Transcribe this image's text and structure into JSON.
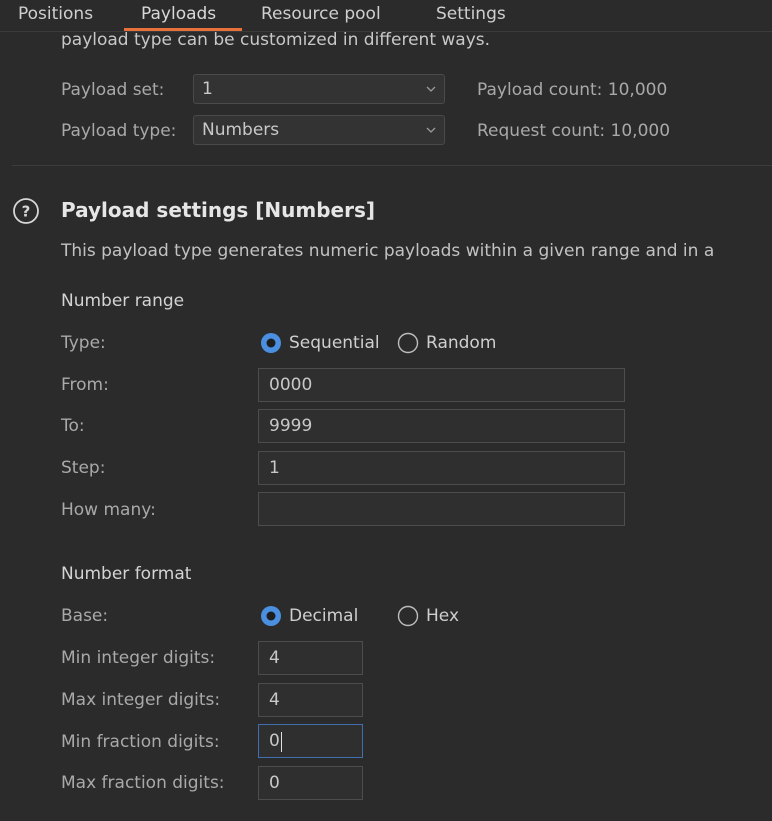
{
  "tabs": [
    {
      "label": "Positions"
    },
    {
      "label": "Payloads",
      "active": true
    },
    {
      "label": "Resource pool"
    },
    {
      "label": "Settings"
    }
  ],
  "payload_sets": {
    "intro_text": "payload type can be customized in different ways.",
    "set_label": "Payload set:",
    "set_value": "1",
    "type_label": "Payload type:",
    "type_value": "Numbers",
    "payload_count": "Payload count: 10,000",
    "request_count": "Request count: 10,000"
  },
  "payload_settings": {
    "title": "Payload settings [Numbers]",
    "description": "This payload type generates numeric payloads within a given range and in a",
    "number_range": {
      "heading": "Number range",
      "type_label": "Type:",
      "options": [
        "Sequential",
        "Random"
      ],
      "selected": "Sequential",
      "from_label": "From:",
      "from_value": "0000",
      "to_label": "To:",
      "to_value": "9999",
      "step_label": "Step:",
      "step_value": "1",
      "how_many_label": "How many:",
      "how_many_value": ""
    },
    "number_format": {
      "heading": "Number format",
      "base_label": "Base:",
      "options": [
        "Decimal",
        "Hex"
      ],
      "selected": "Decimal",
      "min_int_label": "Min integer digits:",
      "min_int_value": "4",
      "max_int_label": "Max integer digits:",
      "max_int_value": "4",
      "min_frac_label": "Min fraction digits:",
      "min_frac_value": "0",
      "max_frac_label": "Max fraction digits:",
      "max_frac_value": "0"
    }
  },
  "colors": {
    "background": "#2b2b2b",
    "accent_tab": "#e8703a",
    "radio_selected": "#4a8fe0",
    "focus_border": "#3f6fae"
  }
}
